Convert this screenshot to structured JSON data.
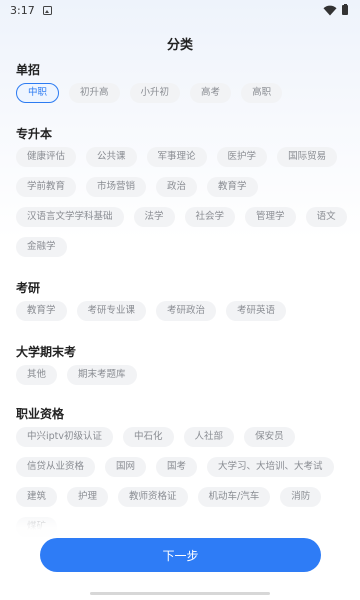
{
  "status_bar": {
    "time": "3:17"
  },
  "header": {
    "title": "分类"
  },
  "sections": [
    {
      "title": "单招",
      "chips": [
        "中职",
        "初升高",
        "小升初",
        "高考",
        "高职"
      ],
      "selected": "中职"
    },
    {
      "title": "专升本",
      "chips": [
        "健康评估",
        "公共课",
        "军事理论",
        "医护学",
        "国际贸易",
        "学前教育",
        "市场营销",
        "政治",
        "教育学",
        "汉语言文学学科基础",
        "法学",
        "社会学",
        "管理学",
        "语文",
        "金融学"
      ]
    },
    {
      "title": "考研",
      "chips": [
        "教育学",
        "考研专业课",
        "考研政治",
        "考研英语"
      ]
    },
    {
      "title": "大学期末考",
      "chips": [
        "其他",
        "期末考题库"
      ]
    },
    {
      "title": "职业资格",
      "chips": [
        "中兴iptv初级认证",
        "中石化",
        "人社部",
        "保安员",
        "信贷从业资格",
        "国网",
        "国考",
        "大学习、大培训、大考试",
        "建筑",
        "护理",
        "教师资格证",
        "机动车/汽车",
        "消防",
        "煤矿"
      ]
    }
  ],
  "footer": {
    "next_label": "下一步"
  },
  "colors": {
    "accent": "#2e7cf6",
    "chip_bg": "#f2f3f5",
    "chip_text": "#8a8d93"
  }
}
